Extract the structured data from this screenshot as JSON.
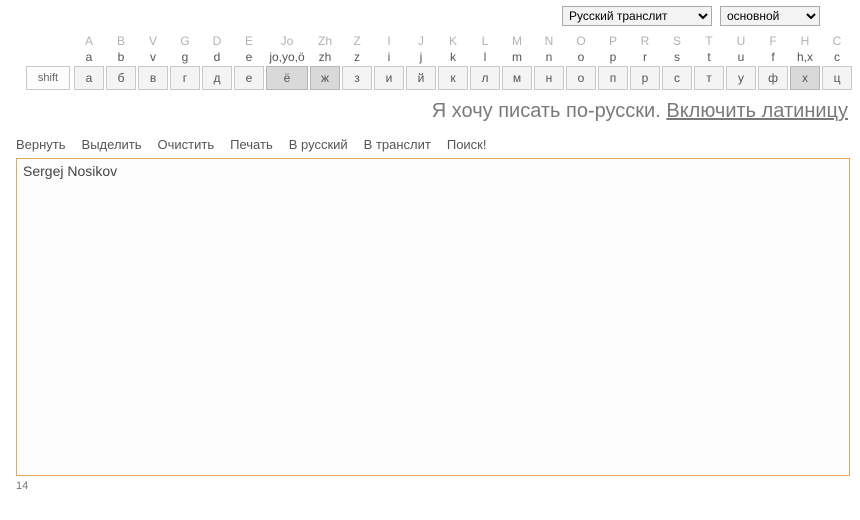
{
  "selects": {
    "mode": "Русский транслит",
    "layout": "основной"
  },
  "keyboard": {
    "cols": [
      {
        "top": "A",
        "bot": "a",
        "ru": "а",
        "hl": false
      },
      {
        "top": "B",
        "bot": "b",
        "ru": "б",
        "hl": false
      },
      {
        "top": "V",
        "bot": "v",
        "ru": "в",
        "hl": false
      },
      {
        "top": "G",
        "bot": "g",
        "ru": "г",
        "hl": false
      },
      {
        "top": "D",
        "bot": "d",
        "ru": "д",
        "hl": false
      },
      {
        "top": "E",
        "bot": "e",
        "ru": "е",
        "hl": false
      },
      {
        "top": "Jo",
        "bot": "jo,yo,ö",
        "ru": "ё",
        "hl": true,
        "wide": true
      },
      {
        "top": "Zh",
        "bot": "zh",
        "ru": "ж",
        "hl": true
      },
      {
        "top": "Z",
        "bot": "z",
        "ru": "з",
        "hl": false
      },
      {
        "top": "I",
        "bot": "i",
        "ru": "и",
        "hl": false
      },
      {
        "top": "J",
        "bot": "j",
        "ru": "й",
        "hl": false
      },
      {
        "top": "K",
        "bot": "k",
        "ru": "к",
        "hl": false
      },
      {
        "top": "L",
        "bot": "l",
        "ru": "л",
        "hl": false
      },
      {
        "top": "M",
        "bot": "m",
        "ru": "м",
        "hl": false
      },
      {
        "top": "N",
        "bot": "n",
        "ru": "н",
        "hl": false
      },
      {
        "top": "O",
        "bot": "o",
        "ru": "о",
        "hl": false
      },
      {
        "top": "P",
        "bot": "p",
        "ru": "п",
        "hl": false
      },
      {
        "top": "R",
        "bot": "r",
        "ru": "р",
        "hl": false
      },
      {
        "top": "S",
        "bot": "s",
        "ru": "с",
        "hl": false
      },
      {
        "top": "T",
        "bot": "t",
        "ru": "т",
        "hl": false
      },
      {
        "top": "U",
        "bot": "u",
        "ru": "у",
        "hl": false
      },
      {
        "top": "F",
        "bot": "f",
        "ru": "ф",
        "hl": false
      },
      {
        "top": "H",
        "bot": "h,x",
        "ru": "х",
        "hl": true
      },
      {
        "top": "C",
        "bot": "c",
        "ru": "ц",
        "hl": false
      }
    ],
    "shift": "shift"
  },
  "promo": {
    "text": "Я хочу писать по-русски. ",
    "link": "Включить латиницу"
  },
  "actions": [
    "Вернуть",
    "Выделить",
    "Очистить",
    "Печать",
    "В русский",
    "В транслит",
    "Поиск!"
  ],
  "textarea": {
    "value": "Sergej Nosikov"
  },
  "counter": "14"
}
